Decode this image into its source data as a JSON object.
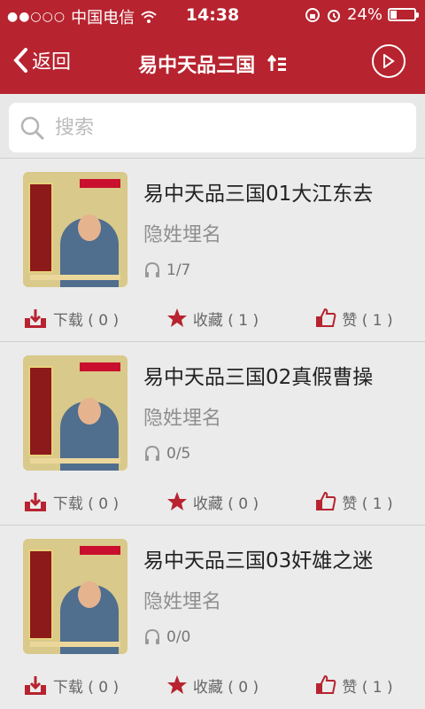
{
  "status_bar": {
    "carrier": "中国电信",
    "time": "14:38",
    "battery": "24%"
  },
  "nav": {
    "back_label": "返回",
    "title": "易中天品三国"
  },
  "search": {
    "placeholder": "搜索"
  },
  "items": [
    {
      "title": "易中天品三国01大江东去",
      "artist": "隐姓埋名",
      "plays": "1/7",
      "download": "下载 ( 0 )",
      "favorite": "收藏 ( 1 )",
      "like": "赞 ( 1 )"
    },
    {
      "title": "易中天品三国02真假曹操",
      "artist": "隐姓埋名",
      "plays": "0/5",
      "download": "下载 ( 0 )",
      "favorite": "收藏 ( 0 )",
      "like": "赞 ( 1 )"
    },
    {
      "title": "易中天品三国03奸雄之迷",
      "artist": "隐姓埋名",
      "plays": "0/0",
      "download": "下载 ( 0 )",
      "favorite": "收藏 ( 0 )",
      "like": "赞 ( 1 )"
    }
  ],
  "colors": {
    "primary": "#b7232f",
    "background": "#ebebeb"
  }
}
